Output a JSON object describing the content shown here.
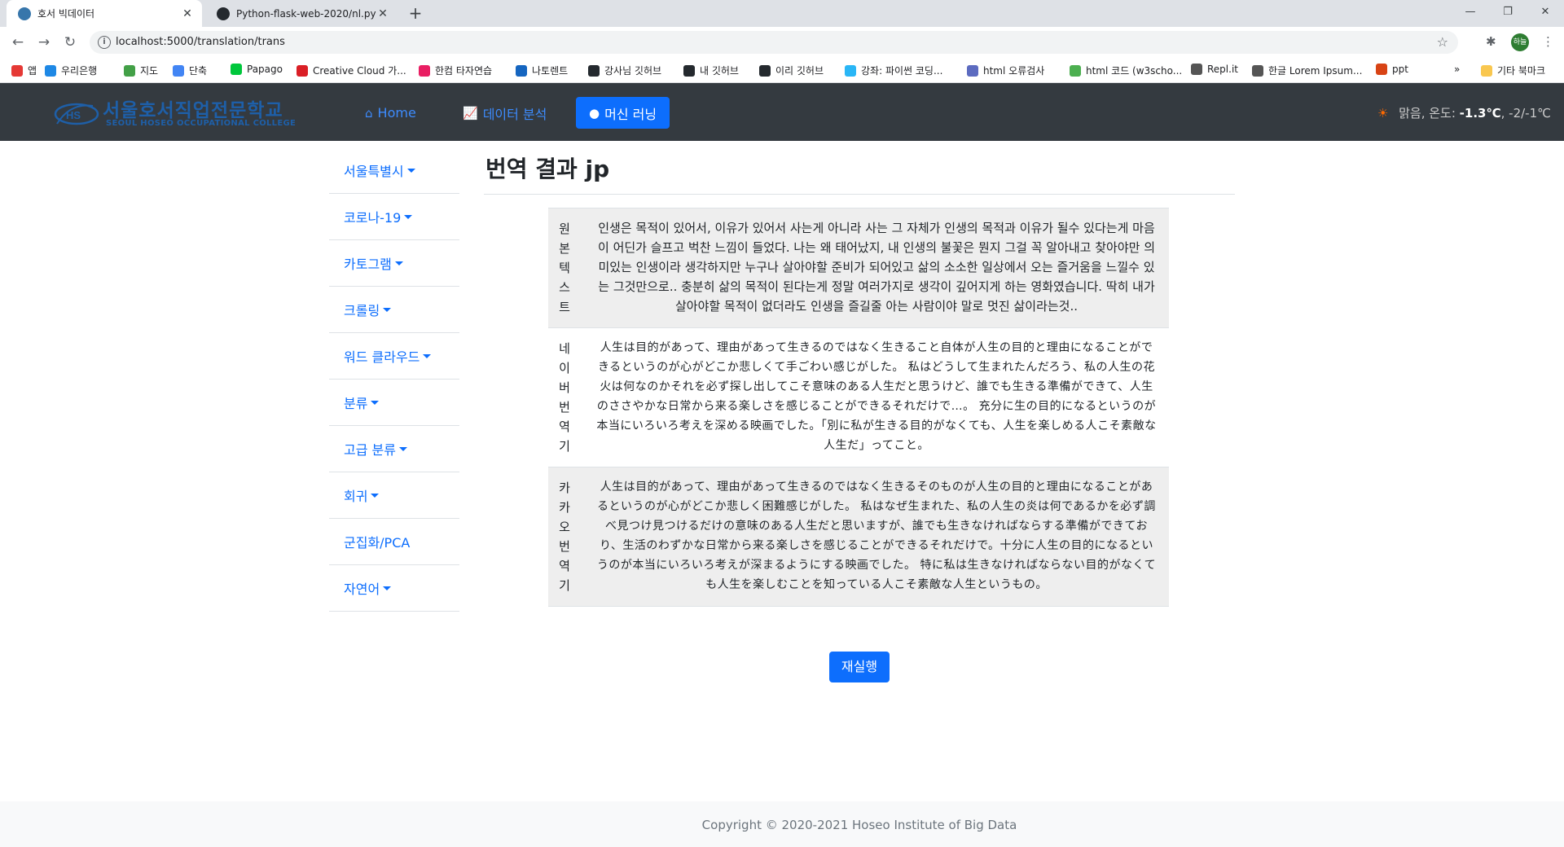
{
  "browser": {
    "tabs": [
      {
        "title": "호서 빅데이터",
        "close": "✕"
      },
      {
        "title": "Python-flask-web-2020/nl.py at",
        "close": "✕"
      }
    ],
    "new_tab": "+",
    "url": "localhost:5000/translation/trans",
    "bookmarks": [
      {
        "label": "앱",
        "color": "#e53935"
      },
      {
        "label": "우리은행",
        "color": "#1e88e5"
      },
      {
        "label": "지도",
        "color": "#43a047"
      },
      {
        "label": "단축",
        "color": "#4285f4"
      },
      {
        "label": "Papago",
        "color": "#00c73c"
      },
      {
        "label": "Creative Cloud 가...",
        "color": "#da1f26"
      },
      {
        "label": "한컴 타자연습",
        "color": "#e91e63"
      },
      {
        "label": "나토렌트",
        "color": "#1565c0"
      },
      {
        "label": "강사님 깃허브",
        "color": "#24292e"
      },
      {
        "label": "내 깃허브",
        "color": "#24292e"
      },
      {
        "label": "이리 깃허브",
        "color": "#24292e"
      },
      {
        "label": "강좌: 파이썬 코딩...",
        "color": "#29b6f6"
      },
      {
        "label": "html 오류검사",
        "color": "#5c6bc0"
      },
      {
        "label": "html 코드 (w3scho...",
        "color": "#4caf50"
      },
      {
        "label": "Repl.it",
        "color": "#555555"
      },
      {
        "label": "한글 Lorem Ipsum...",
        "color": "#555555"
      },
      {
        "label": "ppt",
        "color": "#d84315"
      }
    ],
    "bookmarks_more": "»",
    "other_bookmarks": "기타 북마크",
    "profile": "하늘"
  },
  "app": {
    "logo_kr": "서울호서직업전문학교",
    "logo_en": "SEOUL HOSEO OCCUPATIONAL COLLEGE",
    "nav": [
      {
        "label": "Home",
        "icon": "home-icon"
      },
      {
        "label": "데이터 분석",
        "icon": "chart-icon"
      },
      {
        "label": "머신 러닝",
        "icon": "brain-icon",
        "active": true
      }
    ],
    "weather": {
      "prefix": "맑음, 온도: ",
      "temp": "-1.3℃",
      "range": ", -2/-1℃"
    },
    "accent_color": "#0d6efd"
  },
  "sidebar": {
    "items": [
      {
        "label": "서울특별시",
        "dropdown": true
      },
      {
        "label": "코로나-19",
        "dropdown": true
      },
      {
        "label": "카토그램",
        "dropdown": true
      },
      {
        "label": "크롤링",
        "dropdown": true
      },
      {
        "label": "워드 클라우드",
        "dropdown": true
      },
      {
        "label": "분류",
        "dropdown": true
      },
      {
        "label": "고급 분류",
        "dropdown": true
      },
      {
        "label": "회귀",
        "dropdown": true
      },
      {
        "label": "군집화/PCA",
        "dropdown": false
      },
      {
        "label": "자연어",
        "dropdown": true
      }
    ]
  },
  "main": {
    "title": "번역 결과 jp",
    "rows": [
      {
        "label": "원본텍스트",
        "text": "인생은 목적이 있어서, 이유가 있어서 사는게 아니라 사는 그 자체가 인생의 목적과 이유가 될수 있다는게 마음이 어딘가 슬프고 벅찬 느낌이 들었다. 나는 왜 태어났지, 내 인생의 불꽃은 뭔지 그걸 꼭 알아내고 찾아야만 의미있는 인생이라 생각하지만 누구나 살아야할 준비가 되어있고 삶의 소소한 일상에서 오는 즐거움을 느낄수 있는 그것만으로.. 충분히 삶의 목적이 된다는게 정말 여러가지로 생각이 깊어지게 하는 영화였습니다. 딱히 내가 살아야할 목적이 없더라도 인생을 즐길줄 아는 사람이야 말로 멋진 삶이라는것.."
      },
      {
        "label": "네이버번역기",
        "text": "人生は目的があって、理由があって生きるのではなく生きること自体が人生の目的と理由になることができるというのが心がどこか悲しくて手ごわい感じがした。 私はどうして生まれたんだろう、私の人生の花火は何なのかそれを必ず探し出してこそ意味のある人生だと思うけど、誰でも生きる準備ができて、人生のささやかな日常から来る楽しさを感じることができるそれだけで…。 充分に生の目的になるというのが本当にいろいろ考えを深める映画でした。「別に私が生きる目的がなくても、人生を楽しめる人こそ素敵な人生だ」ってこと。"
      },
      {
        "label": "카카오번역기",
        "text": "人生は目的があって、理由があって生きるのではなく生きるそのものが人生の目的と理由になることがあるというのが心がどこか悲しく困難感じがした。 私はなぜ生まれた、私の人生の炎は何であるかを必ず調べ見つけ見つけるだけの意味のある人生だと思いますが、誰でも生きなければならする準備ができており、生活のわずかな日常から来る楽しさを感じることができるそれだけで。十分に人生の目的になるというのが本当にいろいろ考えが深まるようにする映画でした。 特に私は生きなければならない目的がなくても人生を楽しむことを知っている人こそ素敵な人生というもの。"
      }
    ],
    "rerun_label": "재실행"
  },
  "footer": {
    "copyright": "Copyright © 2020-2021 Hoseo Institute of Big Data"
  }
}
